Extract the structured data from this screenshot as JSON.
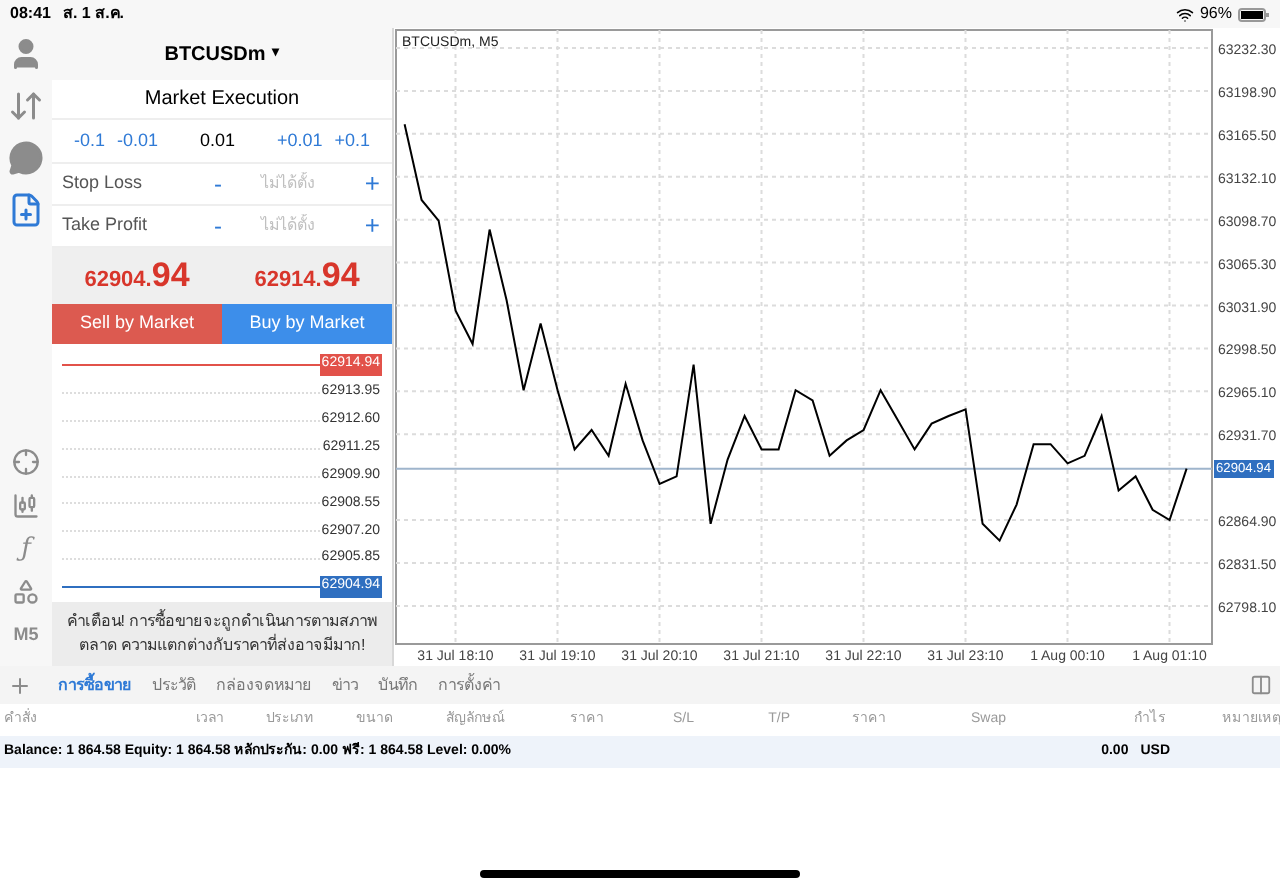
{
  "status_bar": {
    "time": "08:41",
    "date": "ส. 1 ส.ค.",
    "battery": "96%"
  },
  "toolbar": [
    {
      "kind": "account",
      "selected": false
    },
    {
      "kind": "quotes",
      "selected": false
    },
    {
      "kind": "chat",
      "selected": false
    },
    {
      "kind": "order",
      "selected": true
    }
  ],
  "chart_tools": [
    {
      "kind": "crosshair"
    },
    {
      "kind": "candles"
    },
    {
      "kind": "indicator",
      "label": "ƒ"
    },
    {
      "kind": "objects"
    },
    {
      "kind": "text",
      "label": "M5"
    }
  ],
  "order": {
    "symbol": "BTCUSDm",
    "caret": "▾",
    "mode": "Market Execution",
    "volume_steps": [
      {
        "label": "-0.1",
        "kind": "step"
      },
      {
        "label": "-0.01",
        "kind": "step"
      },
      {
        "label": "0.01",
        "kind": "value"
      },
      {
        "label": "+0.01",
        "kind": "step"
      },
      {
        "label": "+0.1",
        "kind": "step"
      }
    ],
    "limits": [
      {
        "label": "Stop Loss",
        "minus": "-",
        "placeholder": "ไม่ได้ตั้ง",
        "plus": "+"
      },
      {
        "label": "Take Profit",
        "minus": "-",
        "placeholder": "ไม่ได้ตั้ง",
        "plus": "+"
      }
    ],
    "bid": {
      "main": "62904.",
      "big": "94"
    },
    "ask": {
      "main": "62914.",
      "big": "94"
    },
    "sell_button": "Sell by Market",
    "buy_button": "Buy by Market",
    "ladder": [
      {
        "price": "62914.94",
        "kind": "ask"
      },
      {
        "price": "62913.95",
        "kind": "level"
      },
      {
        "price": "62912.60",
        "kind": "level"
      },
      {
        "price": "62911.25",
        "kind": "level"
      },
      {
        "price": "62909.90",
        "kind": "level"
      },
      {
        "price": "62908.55",
        "kind": "level"
      },
      {
        "price": "62907.20",
        "kind": "level"
      },
      {
        "price": "62905.85",
        "kind": "level"
      },
      {
        "price": "62904.94",
        "kind": "bid"
      }
    ],
    "warning": "คำเตือน! การซื้อขายจะถูกดำเนินการตามสภาพตลาด ความแตกต่างกับราคาที่ส่งอาจมีมาก!"
  },
  "chart": {
    "chart_data": {
      "type": "line",
      "title": "BTCUSDm, M5",
      "categories": [
        null,
        null,
        null,
        "31 Jul 18:10",
        null,
        null,
        null,
        null,
        null,
        "31 Jul 19:10",
        null,
        null,
        null,
        null,
        null,
        "31 Jul 20:10",
        null,
        null,
        null,
        null,
        null,
        "31 Jul 21:10",
        null,
        null,
        null,
        null,
        null,
        "31 Jul 22:10",
        null,
        null,
        null,
        null,
        null,
        "31 Jul 23:10",
        null,
        null,
        null,
        null,
        null,
        "1 Aug 00:10",
        null,
        null,
        null,
        null,
        null,
        "1 Aug 01:10",
        null,
        null
      ],
      "grid": true,
      "series": [
        {
          "color": "#000000",
          "values": [
            63173,
            63114,
            63098,
            63028,
            63002,
            63091,
            63036,
            62966,
            63018,
            62966,
            62920,
            62935,
            62915,
            62971,
            62927,
            62893,
            62899,
            62986,
            62862,
            62912,
            62946,
            62920,
            62920,
            62966,
            62958,
            62915,
            62927,
            62935,
            62966,
            62943,
            62920,
            62940,
            62946,
            62951,
            62862,
            62849,
            62877,
            62924,
            62924,
            62909,
            62915,
            62946,
            62888,
            62899,
            62873,
            62865,
            62905,
            null
          ]
        }
      ],
      "ylim": [
        62768.5,
        63246.3
      ],
      "yticks": [
        {
          "value": 63232.3,
          "label": "63232.30"
        },
        {
          "value": 63198.9,
          "label": "63198.90"
        },
        {
          "value": 63165.5,
          "label": "63165.50"
        },
        {
          "value": 63132.1,
          "label": "63132.10"
        },
        {
          "value": 63098.7,
          "label": "63098.70"
        },
        {
          "value": 63065.3,
          "label": "63065.30"
        },
        {
          "value": 63031.9,
          "label": "63031.90"
        },
        {
          "value": 62998.5,
          "label": "62998.50"
        },
        {
          "value": 62965.1,
          "label": "62965.10"
        },
        {
          "value": 62931.7,
          "label": "62931.70"
        },
        {
          "value": 62864.9,
          "label": "62864.90"
        },
        {
          "value": 62831.5,
          "label": "62831.50"
        },
        {
          "value": 62798.1,
          "label": "62798.10"
        }
      ],
      "ref_lines": [
        {
          "axis": "y",
          "value": 62904.94,
          "label": "62904.94"
        }
      ]
    }
  },
  "tabs": [
    {
      "label": "การซื้อขาย",
      "selected": true
    },
    {
      "label": "ประวัติ",
      "selected": false
    },
    {
      "label": "กล่องจดหมาย",
      "selected": false
    },
    {
      "label": "ข่าว",
      "selected": false
    },
    {
      "label": "บันทึก",
      "selected": false
    },
    {
      "label": "การตั้งค่า",
      "selected": false
    }
  ],
  "table": {
    "columns": [
      "คำสั่ง",
      "เวลา",
      "ประเภท",
      "ขนาด",
      "สัญลักษณ์",
      "ราคา",
      "S/L",
      "T/P",
      "ราคา",
      "Swap",
      "กำไร",
      "หมายเหตุ"
    ],
    "summary": "Balance: 1 864.58 Equity: 1 864.58 หลักประกัน: 0.00 ฟรี: 1 864.58 Level: 0.00%",
    "profit": "0.00",
    "currency": "USD"
  }
}
